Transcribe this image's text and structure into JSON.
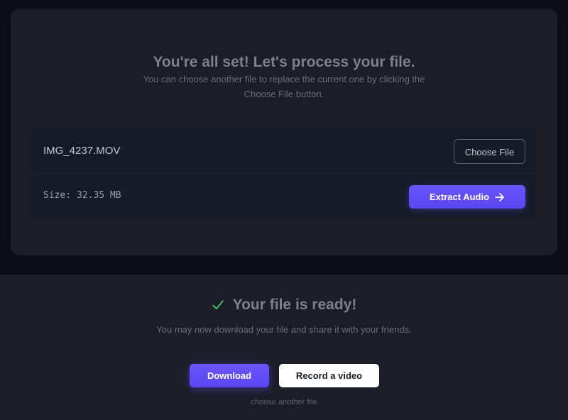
{
  "process": {
    "title": "You're all set! Let's process your file.",
    "subtitle": "You can choose another file to replace the current one by clicking the Choose File button.",
    "file_name": "IMG_4237.MOV",
    "choose_file_label": "Choose File",
    "size_text": "Size: 32.35 MB",
    "extract_label": "Extract Audio",
    "extract_icon": "arrow-right-icon"
  },
  "ready": {
    "icon": "check-icon",
    "title": "Your file is ready!",
    "subtitle": "You may now download your file and share it with your friends.",
    "download_label": "Download",
    "record_label": "Record a video",
    "choose_another_label": "choose another file"
  },
  "colors": {
    "accent": "#6a55ff",
    "success": "#4ade80",
    "card_bg": "#1c1d27",
    "page_bg": "#0b0c15"
  }
}
